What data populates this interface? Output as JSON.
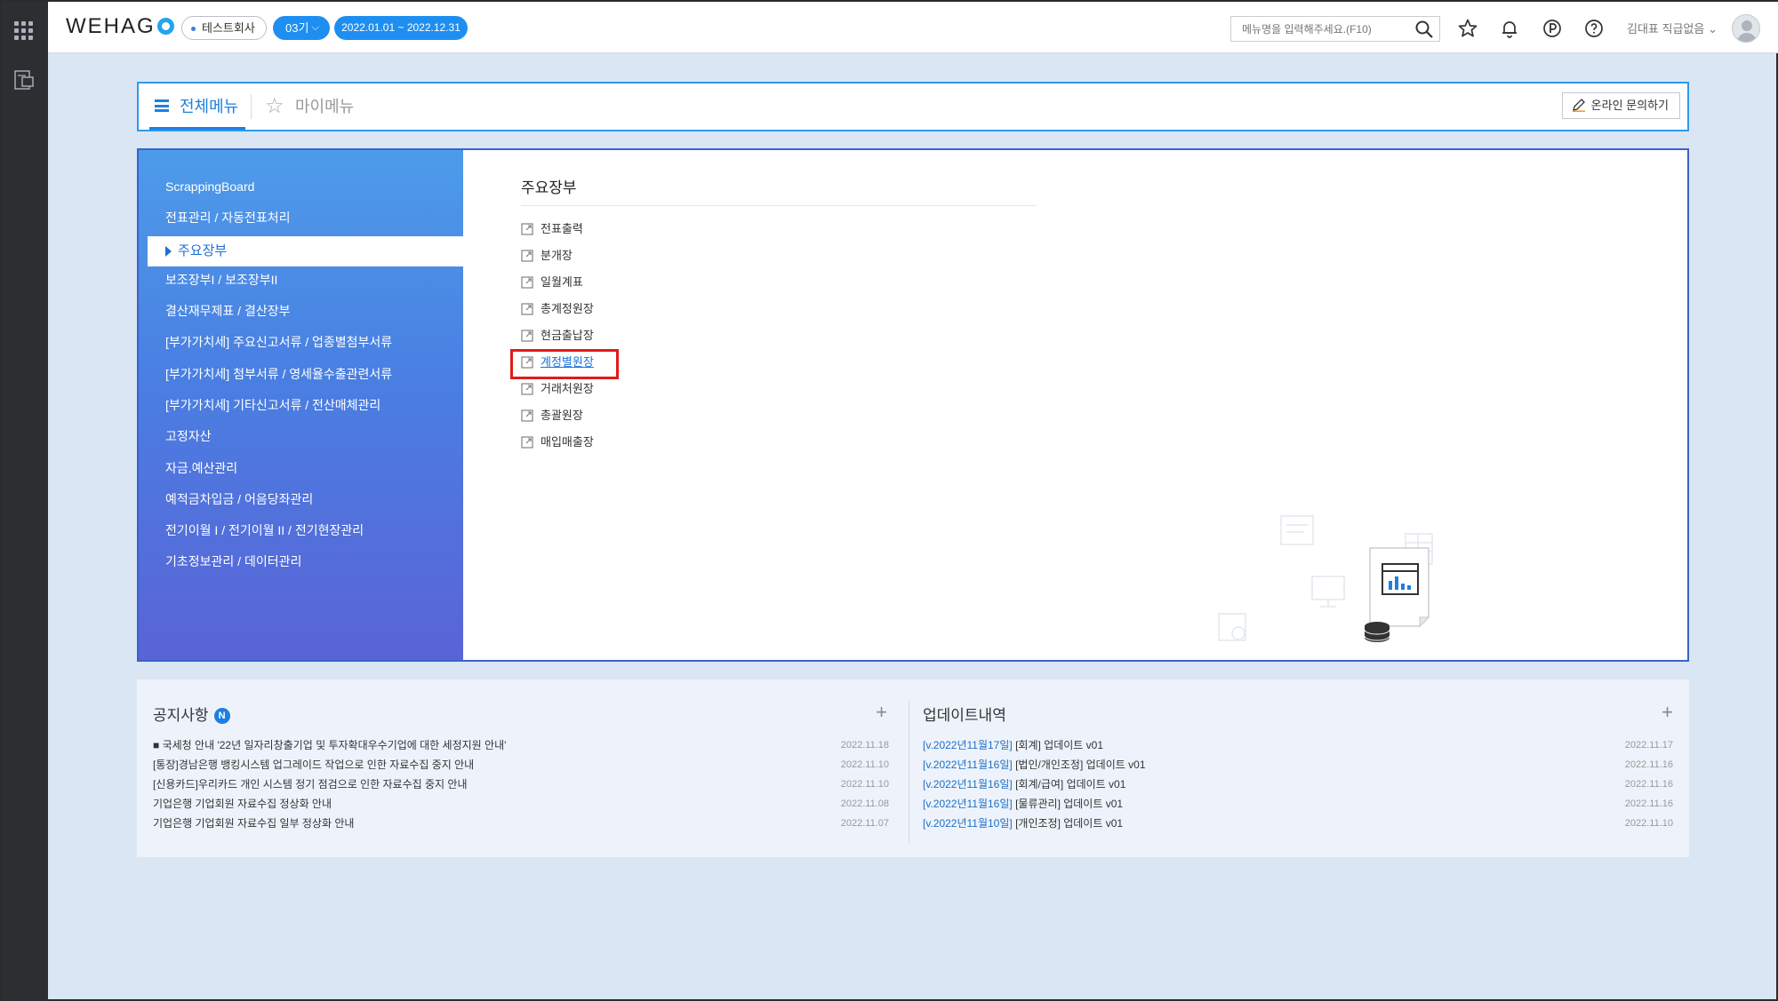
{
  "topbar": {
    "logo": "WEHAG",
    "company": "테스트회사",
    "period": "03기",
    "dates": "2022.01.01 ~ 2022.12.31",
    "search_placeholder": "메뉴명을 입력해주세요.(F10)",
    "user": "김대표 직급없음 ⌄"
  },
  "tabs": {
    "all": "전체메뉴",
    "my": "마이메뉴",
    "inquiry": "온라인 문의하기"
  },
  "sidebar": {
    "items": [
      "ScrappingBoard",
      "전표관리 / 자동전표처리",
      "주요장부",
      "보조장부I / 보조장부II",
      "결산재무제표 / 결산장부",
      "[부가가치세] 주요신고서류 / 업종별첨부서류",
      "[부가가치세] 첨부서류 / 영세율수출관련서류",
      "[부가가치세] 기타신고서류 / 전산매체관리",
      "고정자산",
      "자금.예산관리",
      "예적금차입금 / 어음당좌관리",
      "전기이월 I / 전기이월 II / 전기현장관리",
      "기초정보관리 / 데이터관리"
    ],
    "active_index": 2
  },
  "content": {
    "title": "주요장부",
    "links": [
      "전표출력",
      "분개장",
      "일월계표",
      "총계정원장",
      "현금출납장",
      "계정별원장",
      "거래처원장",
      "총괄원장",
      "매입매출장"
    ],
    "selected_index": 5
  },
  "notices": {
    "title": "공지사항",
    "badge": "N",
    "rows": [
      {
        "text": "■ 국세청 안내 '22년 일자리창출기업 및 투자확대우수기업에 대한 세정지원 안내'",
        "date": "2022.11.18"
      },
      {
        "text": "[통장]경남은행 뱅킹시스템 업그레이드 작업으로 인한 자료수집 중지 안내",
        "date": "2022.11.10"
      },
      {
        "text": "[신용카드]우리카드 개인 시스템 정기 점검으로 인한 자료수집 중지 안내",
        "date": "2022.11.10"
      },
      {
        "text": "기업은행 기업회원 자료수집 정상화 안내",
        "date": "2022.11.08"
      },
      {
        "text": "기업은행 기업회원 자료수집 일부 정상화 안내",
        "date": "2022.11.07"
      }
    ]
  },
  "updates": {
    "title": "업데이트내역",
    "rows": [
      {
        "tag": "[v.2022년11월17일]",
        "text": " [회계] 업데이트 v01",
        "date": "2022.11.17"
      },
      {
        "tag": "[v.2022년11월16일]",
        "text": " [법인/개인조정] 업데이트 v01",
        "date": "2022.11.16"
      },
      {
        "tag": "[v.2022년11월16일]",
        "text": " [회계/급여] 업데이트 v01",
        "date": "2022.11.16"
      },
      {
        "tag": "[v.2022년11월16일]",
        "text": " [물류관리] 업데이트 v01",
        "date": "2022.11.16"
      },
      {
        "tag": "[v.2022년11월10일]",
        "text": " [개인조정] 업데이트 v01",
        "date": "2022.11.10"
      }
    ]
  }
}
